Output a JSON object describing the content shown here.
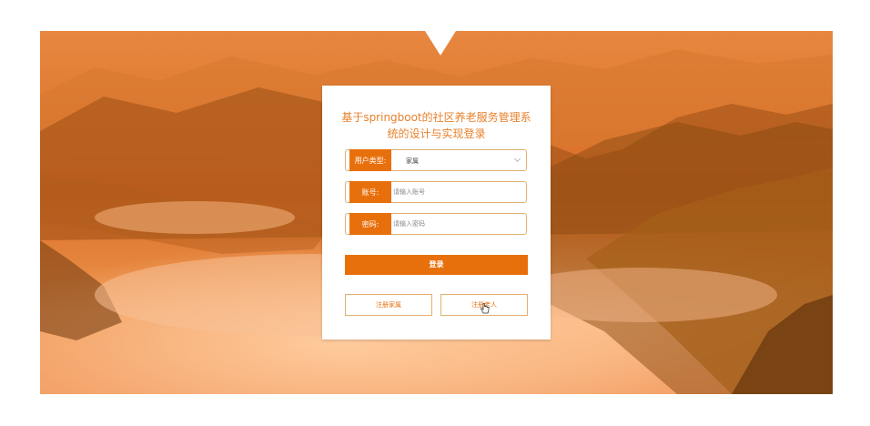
{
  "login": {
    "title": "基于springboot的社区养老服务管理系统的设计与实现登录",
    "user_type": {
      "label": "用户类型:",
      "selected": "家属"
    },
    "account": {
      "label": "账号:",
      "placeholder": "请输入账号"
    },
    "password": {
      "label": "密码:",
      "placeholder": "请输入密码"
    },
    "login_button": "登录",
    "register_family_button": "注册家属",
    "register_elder_button": "注册老人"
  },
  "colors": {
    "accent": "#e8700c",
    "title": "#e8812c",
    "field_border": "#e1b071"
  }
}
